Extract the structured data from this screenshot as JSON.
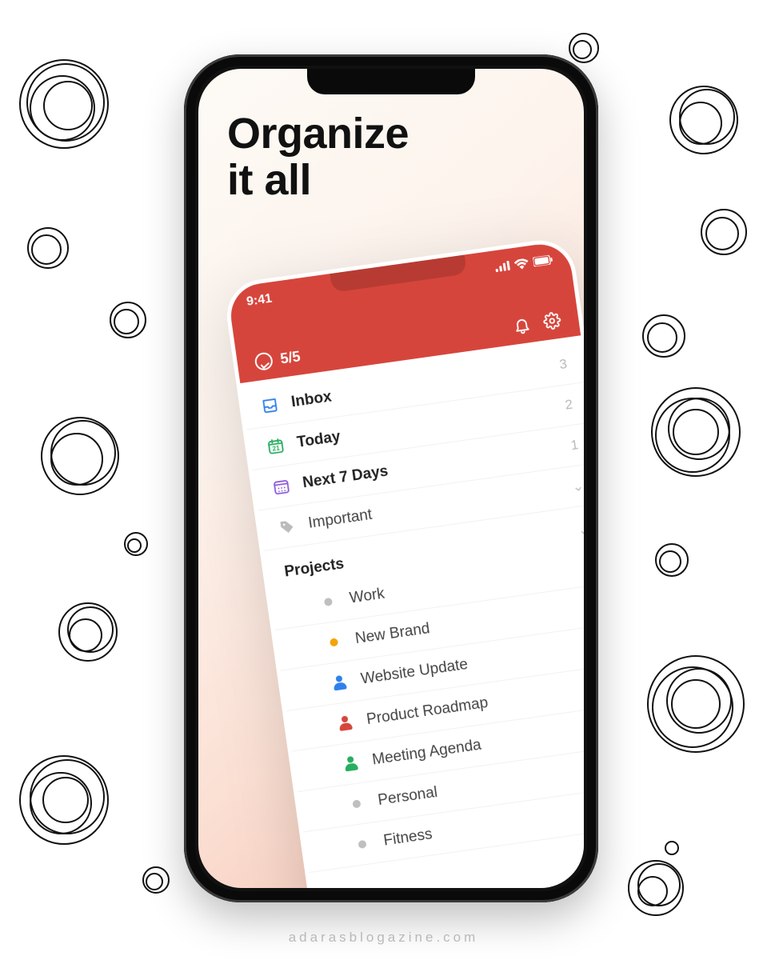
{
  "headline_line1": "Organize",
  "headline_line2": "it all",
  "watermark": "adarasblogazine.com",
  "inner": {
    "status_time": "9:41",
    "progress_label": "5/5",
    "colors": {
      "accent": "#d6453c"
    },
    "filters": {
      "inbox": {
        "label": "Inbox",
        "count": "3",
        "icon": "inbox-icon",
        "icon_color": "#2f80ed"
      },
      "today": {
        "label": "Today",
        "count": "2",
        "icon": "calendar-icon",
        "icon_color": "#27ae60"
      },
      "next7": {
        "label": "Next 7 Days",
        "count": "1",
        "icon": "week-icon",
        "icon_color": "#8e5bd9"
      }
    },
    "tag_row": {
      "label": "Important"
    },
    "projects_header": "Projects",
    "projects": [
      {
        "label": "Work",
        "indent": 1,
        "dot": "#bfbfbf",
        "type": "dot"
      },
      {
        "label": "New Brand",
        "indent": 2,
        "dot": "#f2a40a",
        "type": "dot"
      },
      {
        "label": "Website Update",
        "indent": 2,
        "person": "#2f80ed",
        "type": "person"
      },
      {
        "label": "Product Roadmap",
        "indent": 2,
        "person": "#d6453c",
        "type": "person"
      },
      {
        "label": "Meeting Agenda",
        "indent": 2,
        "person": "#27ae60",
        "type": "person"
      },
      {
        "label": "Personal",
        "indent": 1,
        "dot": "#bfbfbf",
        "type": "dot"
      },
      {
        "label": "Fitness",
        "indent": 2,
        "dot": "#bfbfbf",
        "type": "dot"
      }
    ]
  }
}
